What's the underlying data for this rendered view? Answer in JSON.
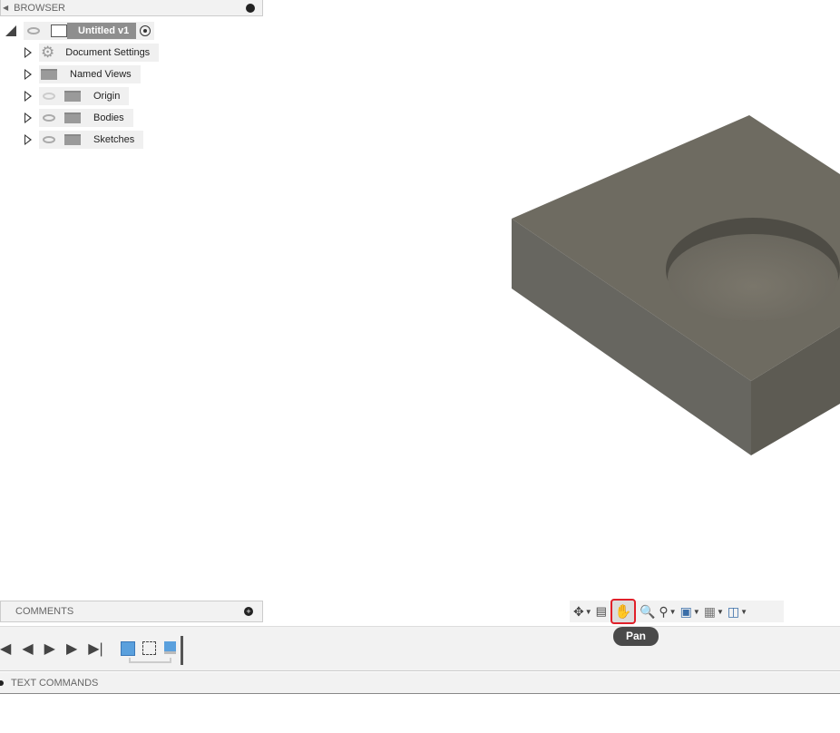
{
  "browser": {
    "title": "BROWSER",
    "root": "Untitled v1",
    "items": [
      {
        "label": "Document Settings",
        "icon": "gear-icon"
      },
      {
        "label": "Named Views",
        "icon": "folder-icon"
      },
      {
        "label": "Origin",
        "icon": "folder-icon",
        "visibility": "hidden"
      },
      {
        "label": "Bodies",
        "icon": "folder-icon",
        "visibility": "visible"
      },
      {
        "label": "Sketches",
        "icon": "folder-icon",
        "visibility": "visible"
      }
    ]
  },
  "comments": {
    "title": "COMMENTS"
  },
  "text_commands": {
    "title": "TEXT COMMANDS"
  },
  "nav_toolbar": {
    "tooltip": "Pan",
    "active": "pan",
    "highlight_color": "#e0202a"
  },
  "colors": {
    "top_face": "#6e6b61",
    "left_face": "#676660",
    "right_face": "#5d5b53"
  }
}
